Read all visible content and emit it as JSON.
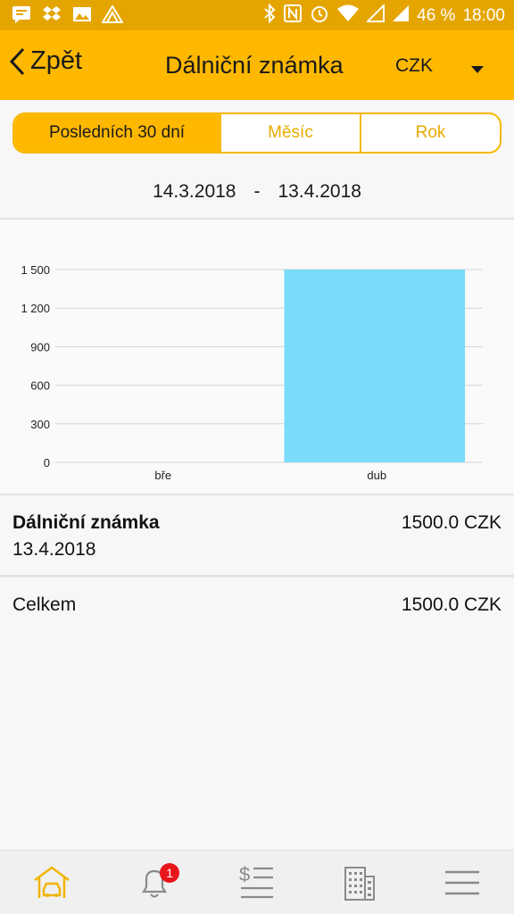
{
  "status_bar": {
    "battery": "46 %",
    "time": "18:00",
    "icons": [
      "message-icon",
      "dropbox-icon",
      "image-icon",
      "app-icon",
      "bluetooth-icon",
      "nfc-icon",
      "alarm-icon",
      "wifi-icon",
      "signal-icon",
      "signal-icon",
      "battery-icon"
    ]
  },
  "header": {
    "back_label": "Zpět",
    "title": "Dálniční známka",
    "currency": "CZK"
  },
  "tabs": [
    {
      "label": "Posledních 30 dní",
      "active": true
    },
    {
      "label": "Měsíc",
      "active": false
    },
    {
      "label": "Rok",
      "active": false
    }
  ],
  "date_range": {
    "from": "14.3.2018",
    "separator": "-",
    "to": "13.4.2018"
  },
  "chart_data": {
    "type": "bar",
    "categories": [
      "bře",
      "dub"
    ],
    "values": [
      0,
      1500
    ],
    "ylim": [
      0,
      1500
    ],
    "yticks": [
      "0",
      "300",
      "600",
      "900",
      "1 200",
      "1 500"
    ],
    "color": "#79dcf8",
    "grid": true
  },
  "expenses": [
    {
      "name": "Dálniční známka",
      "date": "13.4.2018",
      "amount": "1500.0 CZK"
    }
  ],
  "total": {
    "label": "Celkem",
    "amount": "1500.0 CZK"
  },
  "bottom_nav": {
    "items": [
      "car-home-icon",
      "bell-icon",
      "expenses-list-icon",
      "building-icon",
      "menu-icon"
    ],
    "notification_count": "1"
  },
  "colors": {
    "accent": "#ffb800",
    "statusbar": "#e5a500",
    "bar": "#79dcf8",
    "nav_active": "#f0b400",
    "nav_inactive": "#8a8a8a",
    "badge": "#e8151b"
  }
}
